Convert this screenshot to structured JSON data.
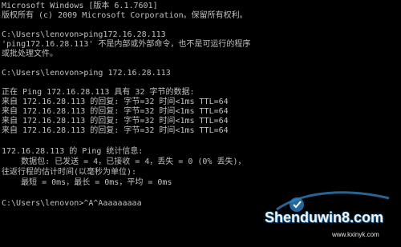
{
  "console": {
    "lines": [
      "Microsoft Windows [版本 6.1.7601]",
      "版权所有 (c) 2009 Microsoft Corporation。保留所有权利。",
      "",
      "C:\\Users\\lenovon>ping172.16.28.113",
      "'ping172.16.28.113' 不是内部或外部命令，也不是可运行的程序",
      "或批处理文件。",
      "",
      "C:\\Users\\lenovon>ping 172.16.28.113",
      "",
      "正在 Ping 172.16.28.113 具有 32 字节的数据:",
      "来自 172.16.28.113 的回复: 字节=32 时间<1ms TTL=64",
      "来自 172.16.28.113 的回复: 字节=32 时间<1ms TTL=64",
      "来自 172.16.28.113 的回复: 字节=32 时间<1ms TTL=64",
      "来自 172.16.28.113 的回复: 字节=32 时间<1ms TTL=64",
      "",
      "172.16.28.113 的 Ping 统计信息:",
      "    数据包: 已发送 = 4，已接收 = 4，丢失 = 0 (0% 丢失)，",
      "往返行程的估计时间(以毫秒为单位):",
      "    最短 = 0ms，最长 = 0ms，平均 = 0ms",
      "",
      "C:\\Users\\lenovon>^A^Aaaaaaaaa"
    ]
  },
  "watermark": {
    "site": "Shenduwin8.com",
    "url": "www.kxinyk.com"
  },
  "colors": {
    "background": "#000000",
    "text": "#c0c0c0"
  }
}
